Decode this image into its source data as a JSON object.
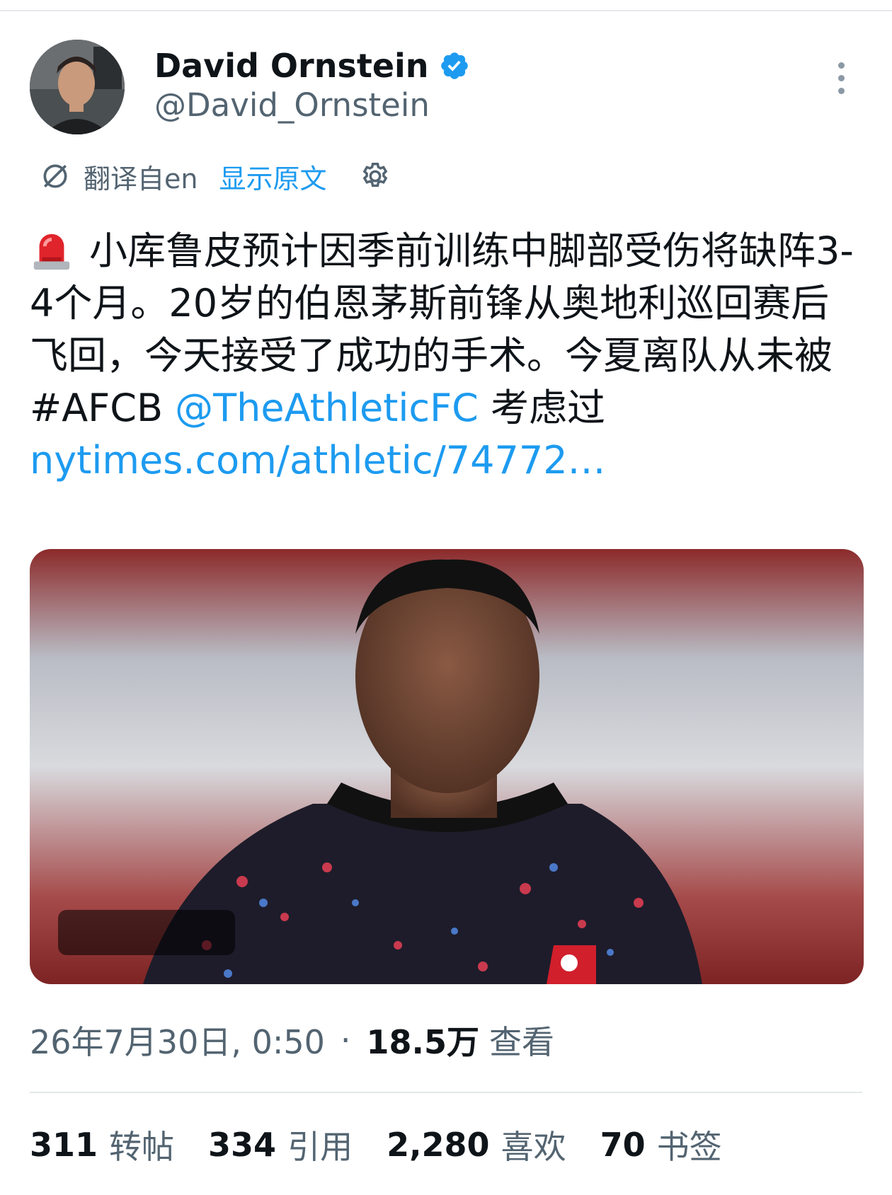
{
  "author": {
    "name": "David Ornstein",
    "handle": "@David_Ornstein"
  },
  "translation": {
    "label": "翻译自en",
    "show_original": "显示原文"
  },
  "tweet": {
    "text_1": "小库鲁皮预计因季前训练中脚部受伤将缺阵3-4个月。20岁的伯恩茅斯前锋从奥地利巡回赛后飞回，今天接受了成功的手术。今夏离队从未被#AFCB ",
    "mention": "@TheAthleticFC",
    "text_2": " 考虑过 ",
    "link": "nytimes.com/athletic/74772…"
  },
  "meta": {
    "datetime": "26年7月30日, 0:50",
    "views_num": "18.5万",
    "views_label": "查看"
  },
  "stats": [
    {
      "num": "311",
      "label": "转帖"
    },
    {
      "num": "334",
      "label": "引用"
    },
    {
      "num": "2,280",
      "label": "喜欢"
    },
    {
      "num": "70",
      "label": "书签"
    }
  ],
  "colors": {
    "accent": "#1d9bf0",
    "secondary_text": "#536471",
    "primary_text": "#0f1419"
  },
  "icons": {
    "verified": "verified-badge-icon",
    "more": "more-vertical-icon",
    "translate": "translate-icon",
    "settings": "gear-icon",
    "alert": "police-light-icon"
  }
}
